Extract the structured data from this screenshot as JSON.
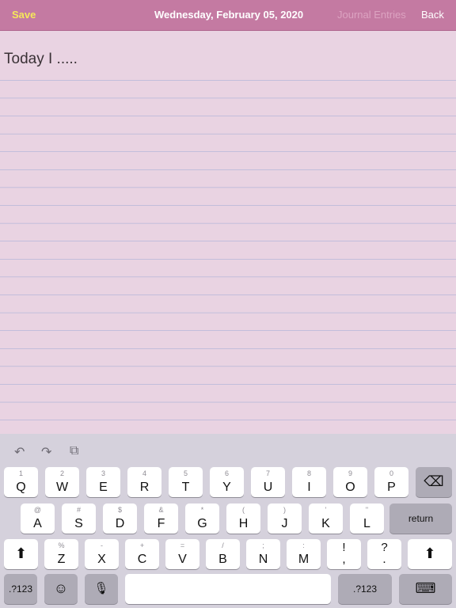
{
  "topbar": {
    "save": "Save",
    "title": "Wednesday, February 05, 2020",
    "entries": "Journal Entries",
    "back": "Back"
  },
  "editor": {
    "text": "Today I ....."
  },
  "keyboard": {
    "toolbar": {
      "undo_icon": "↶",
      "redo_icon": "↷",
      "paste_icon": "⧉"
    },
    "row1": [
      {
        "hint": "1",
        "label": "Q"
      },
      {
        "hint": "2",
        "label": "W"
      },
      {
        "hint": "3",
        "label": "E"
      },
      {
        "hint": "4",
        "label": "R"
      },
      {
        "hint": "5",
        "label": "T"
      },
      {
        "hint": "6",
        "label": "Y"
      },
      {
        "hint": "7",
        "label": "U"
      },
      {
        "hint": "8",
        "label": "I"
      },
      {
        "hint": "9",
        "label": "O"
      },
      {
        "hint": "0",
        "label": "P"
      }
    ],
    "backspace_icon": "⌫",
    "row2": [
      {
        "hint": "@",
        "label": "A"
      },
      {
        "hint": "#",
        "label": "S"
      },
      {
        "hint": "$",
        "label": "D"
      },
      {
        "hint": "&",
        "label": "F"
      },
      {
        "hint": "*",
        "label": "G"
      },
      {
        "hint": "(",
        "label": "H"
      },
      {
        "hint": ")",
        "label": "J"
      },
      {
        "hint": "'",
        "label": "K"
      },
      {
        "hint": "\"",
        "label": "L"
      }
    ],
    "return_label": "return",
    "shift_icon": "⬆",
    "row3": [
      {
        "hint": "%",
        "label": "Z"
      },
      {
        "hint": "-",
        "label": "X"
      },
      {
        "hint": "+",
        "label": "C"
      },
      {
        "hint": "=",
        "label": "V"
      },
      {
        "hint": "/",
        "label": "B"
      },
      {
        "hint": ";",
        "label": "N"
      },
      {
        "hint": ":",
        "label": "M"
      },
      {
        "hint": "!",
        "label": ","
      },
      {
        "hint": "?",
        "label": "."
      }
    ],
    "numbers_label": ".?123",
    "emoji_icon": "☺",
    "mic_icon": "🎙",
    "space_label": "",
    "dismiss_icon": "⌨"
  }
}
